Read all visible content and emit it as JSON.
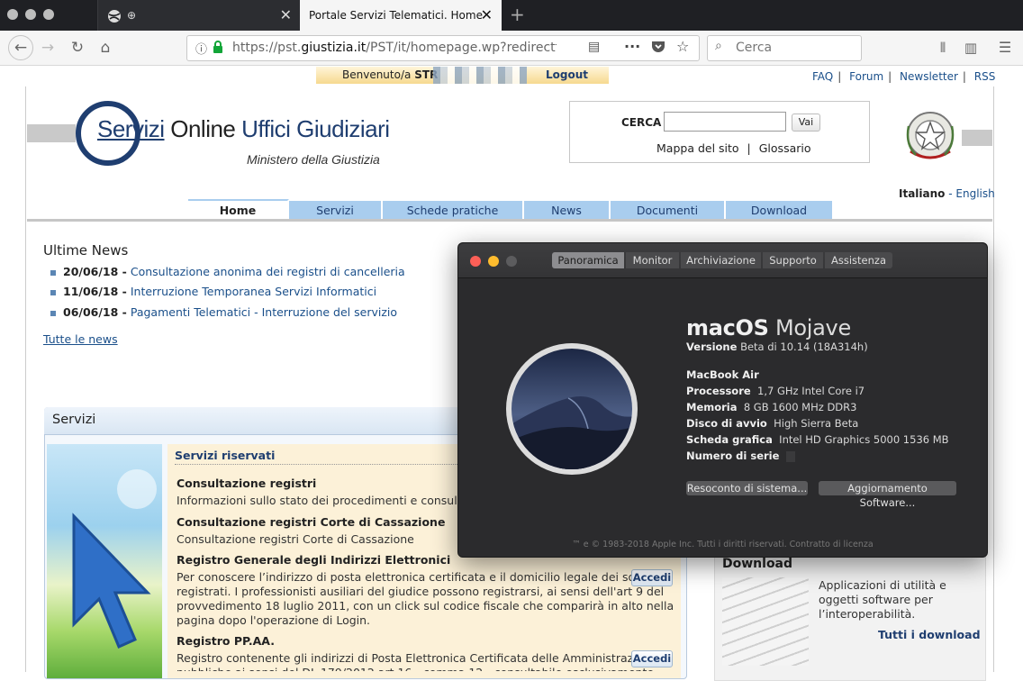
{
  "browser": {
    "tabs": [
      {
        "label": "⊕",
        "active": false
      },
      {
        "label": "Portale Servizi Telematici. Home",
        "active": true
      }
    ],
    "new_tab_label": "+",
    "url_prefix": "https://pst.",
    "url_domain": "giustizia.it",
    "url_rest": "/PST/it/homepage.wp?redirectflag",
    "search_placeholder": "Cerca",
    "icons": [
      "back-icon",
      "forward-icon",
      "reload-icon",
      "home-icon",
      "info-icon",
      "lock-icon",
      "reader-icon",
      "more-icon",
      "pocket-icon",
      "bookmark-star-icon",
      "search-icon",
      "library-icon",
      "sidebar-icon",
      "menu-icon"
    ]
  },
  "page": {
    "welcome_prefix": "Benvenuto/a ",
    "welcome_user": "STR",
    "logout_label": "Logout",
    "top_links": [
      "FAQ",
      "Forum",
      "Newsletter",
      "RSS"
    ],
    "logo_g": "G",
    "logo_servizi": "Servizi",
    "logo_online": " Online ",
    "logo_uffici": "Uffici Giudiziari",
    "logo_sub": "Ministero della Giustizia",
    "search_label": "CERCA",
    "search_button": "Vai",
    "mappa": "Mappa del sito",
    "glossario": "Glossario",
    "lang_it": "Italiano",
    "lang_sep": " - ",
    "lang_en": "English",
    "nav_tabs": [
      "Home",
      "Servizi",
      "Schede pratiche",
      "News",
      "Documenti",
      "Download"
    ],
    "news_title": "Ultime News",
    "news": [
      {
        "date": "20/06/18 -",
        "text": "Consultazione anonima dei registri di cancelleria"
      },
      {
        "date": "11/06/18 -",
        "text": "Interruzione Temporanea Servizi Informatici"
      },
      {
        "date": "06/06/18 -",
        "text": "Pagamenti Telematici - Interruzione del servizio"
      }
    ],
    "tutte_news": "Tutte le news",
    "servizi_title": "Servizi",
    "servizi_riservati": "Servizi riservati",
    "servizi": [
      {
        "title": "Consultazione registri",
        "text": "Informazioni sullo stato dei procedimenti e consultazione"
      },
      {
        "title": "Consultazione registri Corte di Cassazione",
        "text": "Consultazione registri Corte di Cassazione"
      },
      {
        "title": "Registro Generale degli Indirizzi Elettronici",
        "text": "Per conoscere l’indirizzo di posta elettronica certificata e il domicilio legale dei soggetti registrati. I professionisti ausiliari del giudice possono registrarsi, ai sensi dell'art 9 del provvedimento 18 luglio 2011, con un click sul codice fiscale che comparirà in alto nella pagina dopo l'operazione di Login."
      },
      {
        "title": "Registro PP.AA.",
        "text": "Registro contenente gli indirizzi di Posta Elettronica Certificata delle Amministrazioni pubbliche ai sensi del DL 179/2012 art.16 - comma 12 - consultabile esclusivamente"
      }
    ],
    "accedi_label": "Accedi",
    "download_title": "Download",
    "download_text": "Applicazioni di utilità e oggetti software per l’interoperabilità.",
    "download_link": "Tutti i download"
  },
  "mac": {
    "tabs": [
      "Panoramica",
      "Monitor",
      "Archiviazione",
      "Supporto",
      "Assistenza"
    ],
    "os_name_bold": "macOS",
    "os_name_light": "Mojave",
    "version_label": "Versione",
    "version_value": "Beta di 10.14 (18A314h)",
    "model": "MacBook Air",
    "specs": [
      {
        "label": "Processore",
        "value": "1,7 GHz Intel Core i7"
      },
      {
        "label": "Memoria",
        "value": "8 GB 1600 MHz DDR3"
      },
      {
        "label": "Disco di avvio",
        "value": "High Sierra Beta"
      },
      {
        "label": "Scheda grafica",
        "value": "Intel HD Graphics 5000 1536 MB"
      },
      {
        "label": "Numero di serie",
        "value": ""
      }
    ],
    "btn_report": "Resoconto di sistema...",
    "btn_update": "Aggiornamento Software...",
    "footer": "™ e © 1983-2018 Apple Inc. Tutti i diritti riservati. Contratto di licenza"
  }
}
